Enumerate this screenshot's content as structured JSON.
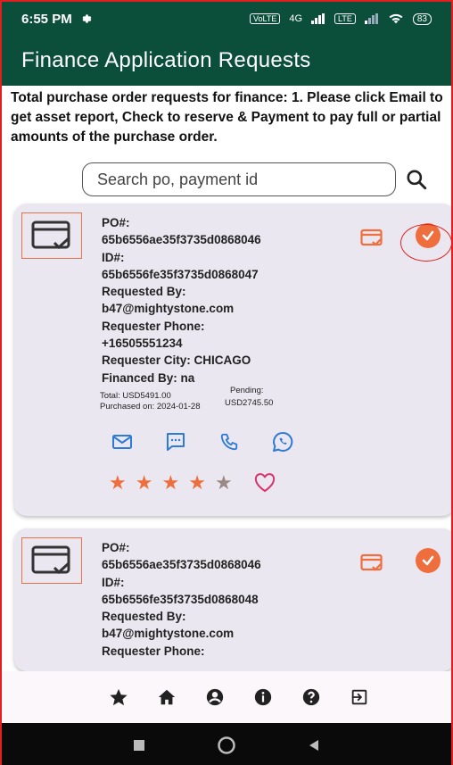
{
  "status_bar": {
    "time": "6:55 PM",
    "network_badges": [
      "VoLTE",
      "4G",
      "LTE"
    ],
    "battery": "83"
  },
  "app_bar": {
    "title": "Finance Application Requests"
  },
  "intro_text": "Total purchase order requests for finance: 1. Please click Email to get asset report, Check to reserve & Payment to pay full or partial amounts of the purchase order.",
  "search": {
    "placeholder": "Search po, payment id"
  },
  "cards": [
    {
      "po_label": "PO#:",
      "po_value": "65b6556ae35f3735d0868046",
      "id_label": "ID#:",
      "id_value": "65b6556fe35f3735d0868047",
      "requested_by_label": "Requested By:",
      "requested_by_value": "b47@mightystone.com",
      "phone_label": "Requester Phone:",
      "phone_value": "+16505551234",
      "city": "Requester City: CHICAGO",
      "financed_by": "Financed By: na",
      "total": "Total: USD5491.00",
      "purchased_on": "Purchased on: 2024-01-28",
      "pending_label": "Pending:",
      "pending_value": "USD2745.50",
      "rating": 4.5
    },
    {
      "po_label": "PO#:",
      "po_value": "65b6556ae35f3735d0868046",
      "id_label": "ID#:",
      "id_value": "65b6556fe35f3735d0868048",
      "requested_by_label": "Requested By:",
      "requested_by_value": "b47@mightystone.com",
      "phone_label": "Requester Phone:"
    }
  ],
  "contact_icons": [
    "email-icon",
    "message-icon",
    "phone-icon",
    "whatsapp-icon"
  ],
  "bottom_nav": [
    "star-icon",
    "home-icon",
    "account-icon",
    "info-icon",
    "help-icon",
    "logout-icon"
  ],
  "system_nav": [
    "recents-icon",
    "home-circle-icon",
    "back-icon"
  ],
  "colors": {
    "primary": "#0b4f3a",
    "accent": "#ee6e3d",
    "card_bg": "#ebe7f0",
    "link_blue": "#2c7bd6",
    "heart": "#d6336c"
  }
}
